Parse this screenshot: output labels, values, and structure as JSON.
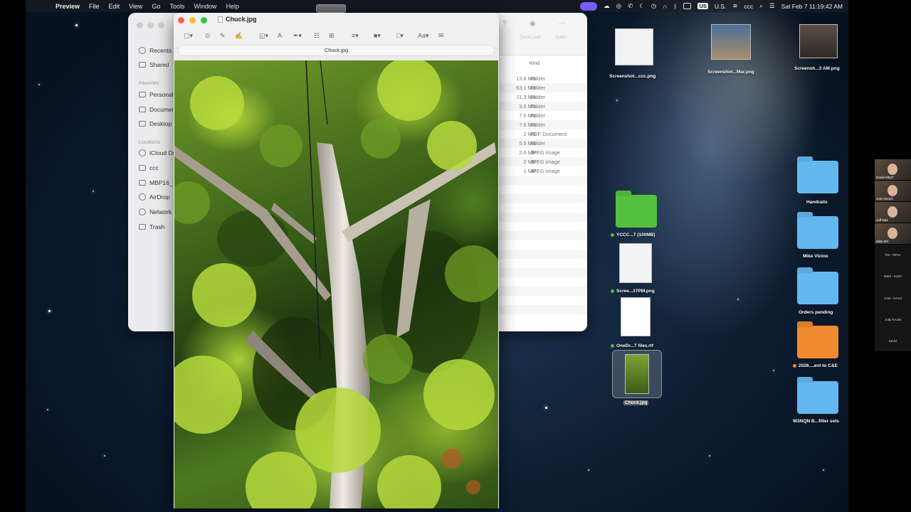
{
  "menubar": {
    "apple_icon": "apple-icon",
    "app_name": "Preview",
    "menus": [
      "File",
      "Edit",
      "View",
      "Go",
      "Tools",
      "Window",
      "Help"
    ],
    "input_source": "U.S.",
    "user": "ccc",
    "clock": "Sat Feb 7  11:19:42 AM"
  },
  "finder": {
    "sidebar": {
      "items_top": [
        "Recents",
        "Shared"
      ],
      "favorites_header": "Favorites",
      "favorites": [
        "Personal",
        "Documents",
        "Desktop"
      ],
      "locations_header": "Locations",
      "locations": [
        "iCloud Drive",
        "ccc",
        "MBP16_",
        "AirDrop",
        "Network",
        "Trash"
      ]
    },
    "toolbar": {
      "quick_look": "Quick Look",
      "action": "Action"
    },
    "kind_header": "Kind",
    "rows": [
      {
        "size": "13.6 MB",
        "kind": "Folder"
      },
      {
        "size": "63.1 MB",
        "kind": "Folder"
      },
      {
        "size": "11.3 MB",
        "kind": "Folder"
      },
      {
        "size": "3.5 MB",
        "kind": "Folder"
      },
      {
        "size": "7.6 MB",
        "kind": "Folder"
      },
      {
        "size": "7.6 MB",
        "kind": "Folder"
      },
      {
        "size": "2 MB",
        "kind": "PDF Document"
      },
      {
        "size": "5.5 MB",
        "kind": "Folder"
      },
      {
        "size": "2.6 MB",
        "kind": "JPEG image"
      },
      {
        "size": "2 MB",
        "kind": "JPEG image"
      },
      {
        "size": "1 MB",
        "kind": "JPEG image"
      }
    ]
  },
  "preview": {
    "title": "Chuck.jpg",
    "filename_bar": "Chuck.jpg",
    "tools": [
      "sidebar-toggle-icon",
      "zoom-icon",
      "markup-icon",
      "sketch-icon",
      "shapes-icon",
      "text-icon",
      "sign-icon",
      "adjust-icon",
      "size-icon",
      "border-color-icon",
      "fill-color-icon",
      "font-icon",
      "annotate-icon"
    ]
  },
  "desktop": {
    "top_items": [
      {
        "label": "Screenshot...ccc.png"
      },
      {
        "label": "Screenshot...Mar.png"
      },
      {
        "label": "Screensh...3 AM.png"
      }
    ],
    "middle_items": [
      {
        "label": "YCCC...7 (100MB)",
        "dot": "#3fbf3f"
      },
      {
        "label": "Scree...37PM.png",
        "dot": "#3fbf3f"
      },
      {
        "label": "OneDr...7 files.rtf",
        "dot": "#3fbf3f"
      },
      {
        "label": "Chuck.jpg",
        "dot": ""
      }
    ],
    "right_folders": [
      {
        "label": "Handrails",
        "color": "blue"
      },
      {
        "label": "Mike Vicino",
        "color": "blue"
      },
      {
        "label": "Orders pending",
        "color": "blue"
      },
      {
        "label": "2026....ent to C&E",
        "color": "orange",
        "dot": "#f08a2e"
      },
      {
        "label": "W3NQN B...filter sets",
        "color": "blue"
      }
    ]
  },
  "participants": {
    "tiles": [
      "David K9QT",
      "John W1DX",
      "Jeff KB1",
      "Mike W1"
    ],
    "names": [
      "Tim - NF1A",
      "Mark - K1ZV",
      "Cam - KA1S",
      "Judy KA1M",
      "Kev1f"
    ]
  }
}
